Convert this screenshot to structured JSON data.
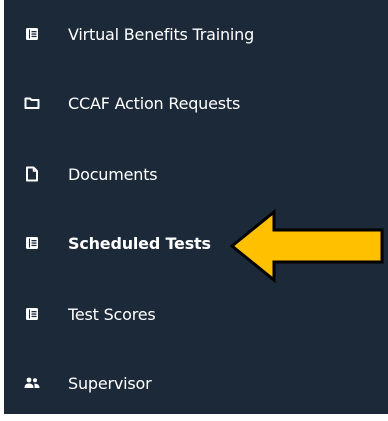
{
  "sidebar": {
    "items": [
      {
        "label": "Virtual Benefits Training",
        "icon": "list-book-icon",
        "active": false
      },
      {
        "label": "CCAF Action Requests",
        "icon": "folder-icon",
        "active": false
      },
      {
        "label": "Documents",
        "icon": "document-icon",
        "active": false
      },
      {
        "label": "Scheduled Tests",
        "icon": "list-book-icon",
        "active": true
      },
      {
        "label": "Test Scores",
        "icon": "list-book-icon",
        "active": false
      },
      {
        "label": "Supervisor",
        "icon": "users-icon",
        "active": false
      }
    ]
  },
  "annotation": {
    "arrow_color": "#ffc000",
    "arrow_outline": "#000000",
    "points_to": "Scheduled Tests"
  },
  "colors": {
    "sidebar_bg": "#1c2939",
    "text": "#ffffff"
  }
}
